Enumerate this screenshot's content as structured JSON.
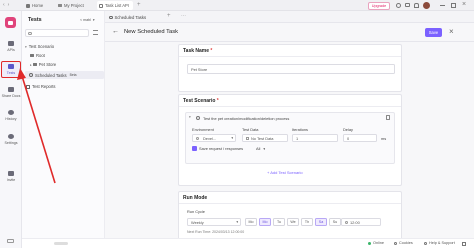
{
  "colors": {
    "accent": "#7b61ff",
    "brand": "#e0447b",
    "annotation": "#e02a2a",
    "upgrade": "#e2246b",
    "apifox_badge": "#e0447b"
  },
  "topbar": {
    "tabs": [
      {
        "label": "Home",
        "icon": "home-icon"
      },
      {
        "label": "My Project",
        "icon": "folder-icon"
      },
      {
        "label": "Task List API",
        "icon": "api-icon"
      }
    ],
    "upgrade_label": "Upgrade"
  },
  "rail": {
    "items": [
      {
        "label": "APIs",
        "icon": "api-icon"
      },
      {
        "label": "Tests",
        "icon": "tests-icon"
      },
      {
        "label": "Share Docs",
        "icon": "share-docs-icon"
      },
      {
        "label": "History",
        "icon": "history-icon"
      },
      {
        "label": "Settings",
        "icon": "settings-icon"
      },
      {
        "label": "Invite",
        "icon": "invite-icon"
      }
    ]
  },
  "sidebar": {
    "title": "Tests",
    "env_label": "< mabl",
    "tree": [
      {
        "label": "Test Scenario",
        "icon": "folder-icon"
      },
      {
        "label": "Root",
        "icon": "folder-icon"
      },
      {
        "label": "Pet Store",
        "icon": "folder-icon"
      },
      {
        "label": "Scheduled Tasks",
        "icon": "clock-icon",
        "badge": "Beta"
      },
      {
        "label": "Test Reports",
        "icon": "report-icon"
      }
    ]
  },
  "main": {
    "tab_label": "Scheduled Tasks",
    "page_title": "New Scheduled Task",
    "save_label": "Save",
    "task_name": {
      "title": "Task Name",
      "value": "Pet Store"
    },
    "scenario": {
      "title": "Test Scenario",
      "item_label": "Test the pet creation/modification/deletion process",
      "columns": [
        "Environment",
        "Test Data",
        "Iterations",
        "Delay"
      ],
      "row": {
        "environment": "Devel...",
        "test_data": "No Test Data",
        "iterations": "1",
        "delay": "0",
        "delay_unit": "ms"
      },
      "save_request": "Save request / responses",
      "save_request_value": "All",
      "add_label": "+ Add Test Scenario"
    },
    "run_mode": {
      "title": "Run Mode",
      "run_cycle_label": "Run Cycle",
      "cycle_value": "Weekly",
      "days": [
        {
          "label": "Mo",
          "selected": false
        },
        {
          "label": "Mo",
          "selected": true
        },
        {
          "label": "Tu",
          "selected": false
        },
        {
          "label": "We",
          "selected": false
        },
        {
          "label": "Th",
          "selected": false
        },
        {
          "label": "Sa",
          "selected": true
        },
        {
          "label": "Su",
          "selected": false
        }
      ],
      "time_value": "12:00",
      "next_run": "Next Run Time: 2024/03/13 12:00:00"
    }
  },
  "statusbar": {
    "online": "Online",
    "cookies": "Cookies",
    "help": "Help & Support"
  }
}
